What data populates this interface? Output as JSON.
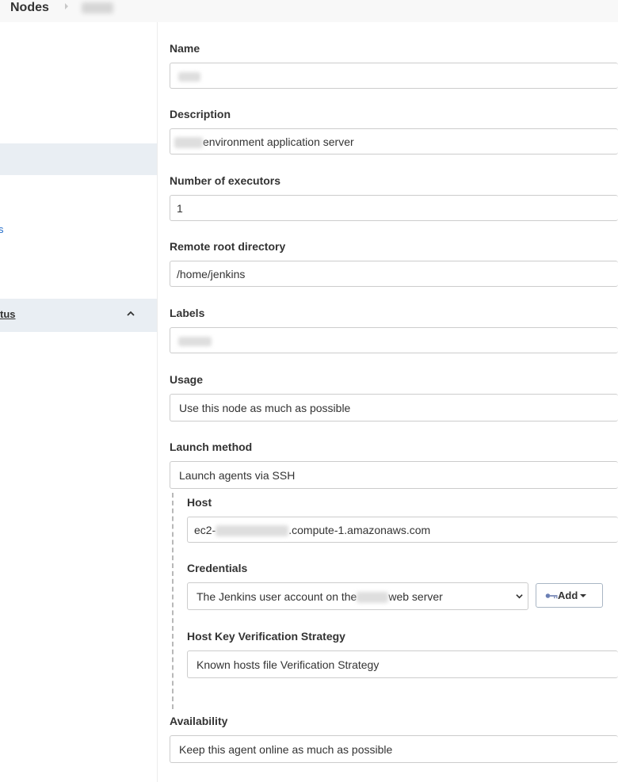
{
  "breadcrumb": {
    "root": "Nodes"
  },
  "sidebar": {
    "link_fragment": "s",
    "section_label": "tus"
  },
  "form": {
    "name": {
      "label": "Name",
      "value": ""
    },
    "description": {
      "label": "Description",
      "value_suffix": "environment application server"
    },
    "executors": {
      "label": "Number of executors",
      "value": "1"
    },
    "remote_root": {
      "label": "Remote root directory",
      "value": "/home/jenkins"
    },
    "labels": {
      "label": "Labels",
      "value": ""
    },
    "usage": {
      "label": "Usage",
      "selected": "Use this node as much as possible"
    },
    "launch_method": {
      "label": "Launch method",
      "selected": "Launch agents via SSH"
    },
    "host": {
      "label": "Host",
      "value_prefix": "ec2-",
      "value_suffix": ".compute-1.amazonaws.com"
    },
    "credentials": {
      "label": "Credentials",
      "selected_prefix": "The Jenkins user account on the",
      "selected_suffix": "web server",
      "add_label": "Add"
    },
    "host_key": {
      "label": "Host Key Verification Strategy",
      "selected": "Known hosts file Verification Strategy"
    },
    "availability": {
      "label": "Availability",
      "selected": "Keep this agent online as much as possible"
    }
  },
  "icons": {
    "breadcrumb_separator": "chevron-right-icon",
    "section_toggle": "chevron-up-icon",
    "credential_add": "key-icon",
    "dropdown": "caret-down-icon"
  },
  "colors": {
    "link": "#1e6ac8",
    "sidebar_highlight": "#e9eef3",
    "breadcrumb_bg": "#f8f8f8"
  }
}
